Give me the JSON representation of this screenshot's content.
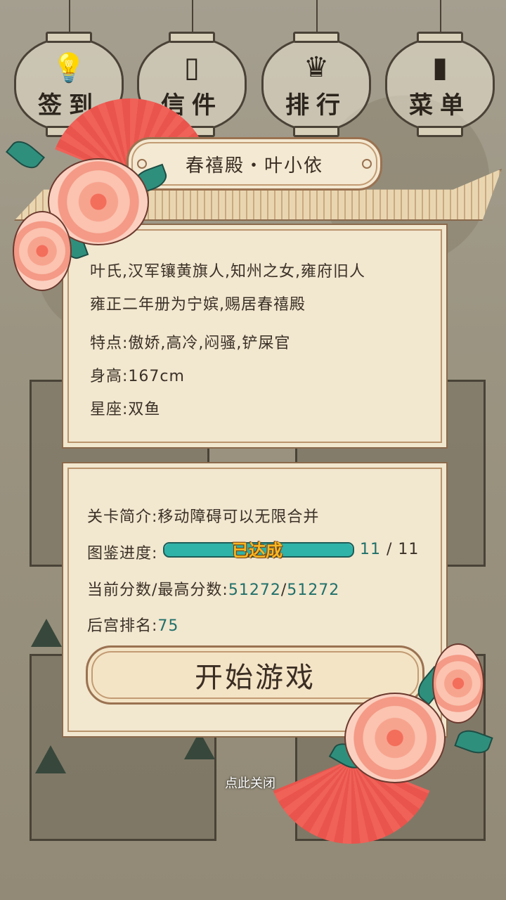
{
  "top_menu": {
    "items": [
      {
        "label": "签到",
        "icon": "bulb-icon"
      },
      {
        "label": "信件",
        "icon": "letter-icon"
      },
      {
        "label": "排行",
        "icon": "crown-icon"
      },
      {
        "label": "菜单",
        "icon": "book-icon"
      }
    ]
  },
  "character": {
    "title": "春禧殿・叶小依",
    "bio_line1": "叶氏,汉军镶黄旗人,知州之女,雍府旧人",
    "bio_line2": "雍正二年册为宁嫔,赐居春禧殿",
    "traits": "特点:傲娇,高冷,闷骚,铲屎官",
    "height": "身高:167cm",
    "constellation": "星座:双鱼"
  },
  "level": {
    "intro": "关卡简介:移动障碍可以无限合并",
    "progress_label": "图鉴进度:",
    "progress_status": "已达成",
    "progress_current": "11",
    "progress_sep": "/",
    "progress_total": "11",
    "progress_ratio": 1.0,
    "score_label": "当前分数/最高分数:",
    "score_current": "51272",
    "score_sep": "/",
    "score_best": "51272",
    "rank_label": "后宫排名:",
    "rank_value": "75"
  },
  "start_button": "开始游戏",
  "close_hint": "点此关闭",
  "colors": {
    "accent_teal": "#20706a",
    "progress": "#2fb3a8",
    "status_gold": "#f6b824"
  }
}
